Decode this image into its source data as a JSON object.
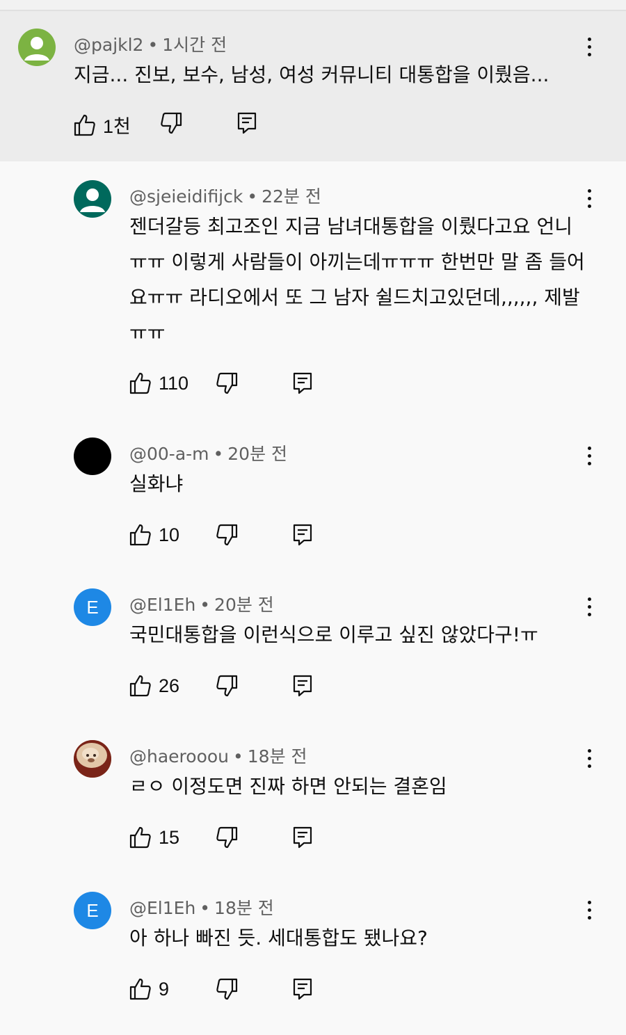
{
  "comments": [
    {
      "username": "@pajkl2",
      "time": "1시간 전",
      "text": "지금... 진보, 보수, 남성, 여성 커뮤니티 대통합을 이뤘음...",
      "likes": "1천",
      "avatar": {
        "type": "default-person",
        "bg": "#7cb342"
      }
    },
    {
      "username": "@sjeieidifijck",
      "time": "22분 전",
      "text": "젠더갈등 최고조인 지금 남녀대통합을 이뤘다고요 언니 ㅠㅠ 이렇게 사람들이 아끼는데ㅠㅠㅠ 한번만 말 좀 들어요ㅠㅠ 라디오에서 또 그 남자 쉴드치고있던데,,,,,, 제발ㅠㅠ",
      "likes": "110",
      "avatar": {
        "type": "default-person",
        "bg": "#00695c"
      }
    },
    {
      "username": "@00-a-m",
      "time": "20분 전",
      "text": "실화냐",
      "likes": "10",
      "avatar": {
        "type": "solid",
        "bg": "#000000"
      }
    },
    {
      "username": "@El1Eh",
      "time": "20분 전",
      "text": "국민대통합을 이런식으로 이루고 싶진 않았다구!ㅠ",
      "likes": "26",
      "avatar": {
        "type": "letter",
        "letter": "E",
        "bg": "#1e88e5"
      }
    },
    {
      "username": "@haerooou",
      "time": "18분 전",
      "text": "ㄹㅇ 이정도면 진짜 하면 안되는 결혼임",
      "likes": "15",
      "avatar": {
        "type": "photo",
        "bg": "#b08968"
      }
    },
    {
      "username": "@El1Eh",
      "time": "18분 전",
      "text": "아 하나 빠진 듯. 세대통합도 됐나요?",
      "likes": "9",
      "avatar": {
        "type": "letter",
        "letter": "E",
        "bg": "#1e88e5"
      }
    }
  ],
  "icons": {
    "like": "thumbs-up-icon",
    "dislike": "thumbs-down-icon",
    "reply": "reply-icon",
    "more": "more-vertical-icon"
  }
}
